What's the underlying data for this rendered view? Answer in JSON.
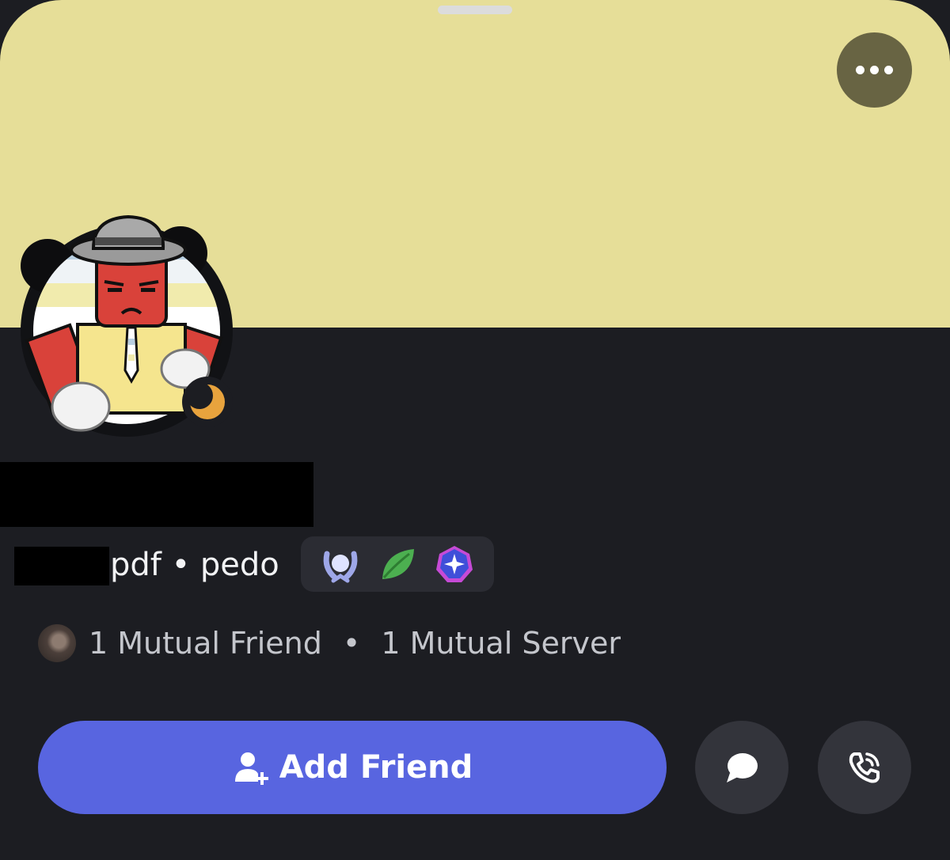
{
  "profile": {
    "tag_text": "pdf • pedo",
    "more_button_label": "More options"
  },
  "badges": [
    {
      "icon": "laurel-wreath-badge-icon",
      "color": "#9ea7e8"
    },
    {
      "icon": "leaf-badge-icon",
      "color": "#4caf50"
    },
    {
      "icon": "gem-badge-icon",
      "color": "#8b5cf6"
    }
  ],
  "mutuals": {
    "friends": "1 Mutual Friend",
    "separator": "•",
    "servers": "1 Mutual Server"
  },
  "actions": {
    "add_friend_label": "Add Friend",
    "message_icon": "chat-bubble-icon",
    "call_icon": "phone-call-icon"
  },
  "colors": {
    "banner": "#e6de98",
    "background": "#1c1d22",
    "accent": "#5865e0"
  }
}
